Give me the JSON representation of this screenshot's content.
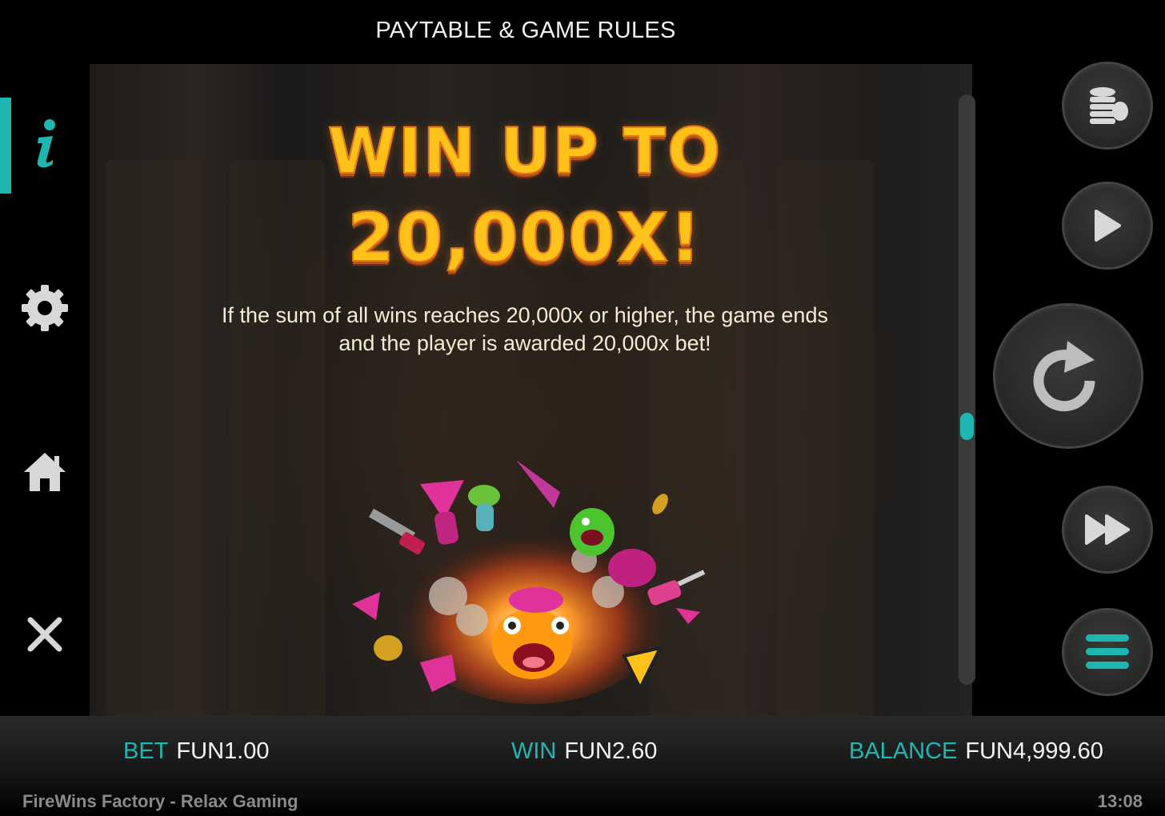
{
  "header": {
    "title": "PAYTABLE & GAME RULES"
  },
  "sidebar": {
    "items": [
      {
        "name": "info",
        "icon": "info-icon",
        "active": true
      },
      {
        "name": "settings",
        "icon": "gear-icon"
      },
      {
        "name": "home",
        "icon": "home-icon"
      },
      {
        "name": "close",
        "icon": "close-icon"
      }
    ]
  },
  "content": {
    "title_line1": "WIN UP TO",
    "title_line2": "20,000X!",
    "description": "If the sum of all wins reaches 20,000x or higher, the game ends and the player is awarded 20,000x bet!",
    "illustration": "explosion-characters-art"
  },
  "controls": [
    {
      "name": "bet-coins-button",
      "icon": "coins-icon"
    },
    {
      "name": "autoplay-button",
      "icon": "play-icon"
    },
    {
      "name": "spin-button",
      "icon": "refresh-icon"
    },
    {
      "name": "turbo-button",
      "icon": "fast-forward-icon"
    },
    {
      "name": "menu-button",
      "icon": "menu-icon"
    }
  ],
  "footer": {
    "bet_label": "BET",
    "bet_value": "FUN1.00",
    "win_label": "WIN",
    "win_value": "FUN2.60",
    "balance_label": "BALANCE",
    "balance_value": "FUN4,999.60",
    "game_name": "FireWins Factory - Relax Gaming",
    "time": "13:08"
  },
  "colors": {
    "accent": "#1fb5b0",
    "title_gold": "#ffc21a",
    "title_shadow": "#b8551c"
  }
}
